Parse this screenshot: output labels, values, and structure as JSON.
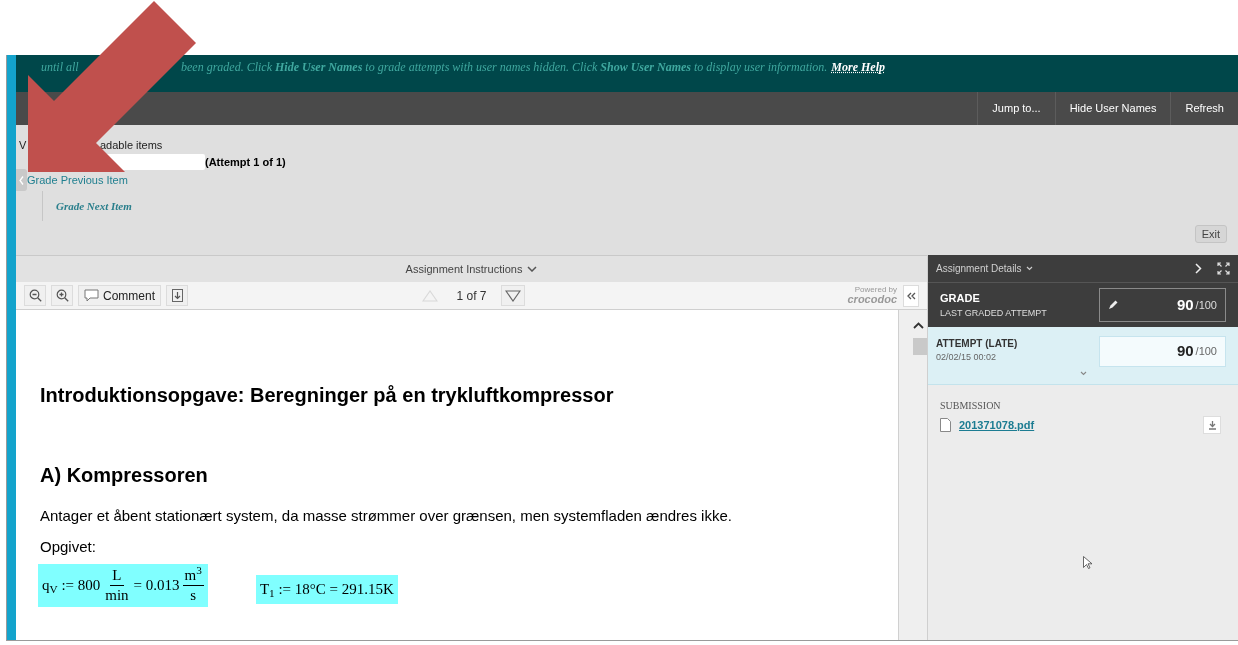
{
  "banner": {
    "text_start": "until all",
    "text": "been graded. Click **Hide User Names** to grade attempts with user names hidden. Click **Show User Names** to display user information.",
    "link": "More Help"
  },
  "nav_buttons": [
    "Jump to...",
    "Hide User Names",
    "Refresh"
  ],
  "header": {
    "label_start": "V",
    "label_end": "adable items",
    "attempt": "(Attempt 1 of 1)",
    "prev_link": "Grade Previous Item",
    "next_link": "Grade Next Item",
    "exit": "Exit"
  },
  "instructions_bar": {
    "label": "Assignment Instructions"
  },
  "toolbar": {
    "comment": "Comment",
    "page": "1 of 7",
    "prev_disabled": true,
    "powered_by": "Powered by",
    "brand": "crocodoc"
  },
  "document": {
    "title": "Introduktionsopgave: Beregninger på en trykluftkompressor",
    "heading": "A) Kompressoren",
    "paragraph": "Antager et åbent stationært system, da masse strømmer over grænsen, men systemfladen ændres ikke.",
    "given_label": "Opgivet:",
    "formulas": [
      {
        "parts": [
          {
            "text": "q$_{V}$ := 800"
          },
          {
            "num": "L",
            "den": "min"
          },
          {
            "text": "= 0.013"
          },
          {
            "num": "m$^{3}$",
            "den": "s"
          }
        ]
      },
      {
        "parts": [
          {
            "text": "T$_{1}$ := 18°C = 291.15K"
          }
        ]
      }
    ]
  },
  "details": {
    "title": "Assignment Details",
    "grade_label": "GRADE",
    "grade_sub": "LAST GRADED ATTEMPT",
    "grade": "90",
    "grade_max": "/100",
    "attempt_label": "ATTEMPT (LATE)",
    "attempt_date": "02/02/15 00:02",
    "attempt_grade": "90",
    "attempt_max": "/100",
    "submission_label": "SUBMISSION",
    "file": "201371078.pdf"
  }
}
